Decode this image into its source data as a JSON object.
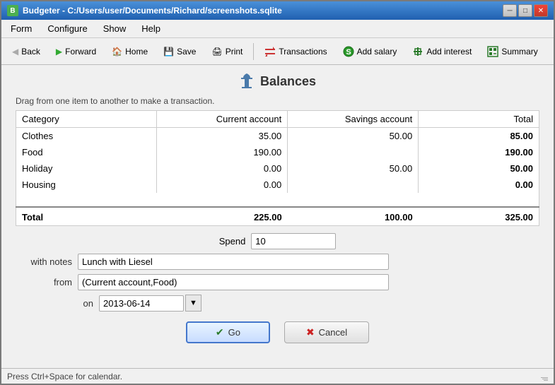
{
  "window": {
    "title": "Budgeter - C:/Users/user/Documents/Richard/screenshots.sqlite"
  },
  "menu": {
    "items": [
      {
        "id": "form",
        "label": "Form"
      },
      {
        "id": "configure",
        "label": "Configure"
      },
      {
        "id": "show",
        "label": "Show"
      },
      {
        "id": "help",
        "label": "Help"
      }
    ]
  },
  "toolbar": {
    "back_label": "Back",
    "forward_label": "Forward",
    "home_label": "Home",
    "save_label": "Save",
    "print_label": "Print",
    "transactions_label": "Transactions",
    "add_salary_label": "Add salary",
    "add_interest_label": "Add interest",
    "summary_label": "Summary"
  },
  "page": {
    "title": "Balances",
    "instruction": "Drag from one item to another to make a transaction."
  },
  "table": {
    "headers": [
      "Category",
      "Current account",
      "Savings account",
      "Total"
    ],
    "rows": [
      {
        "category": "Clothes",
        "current": "35.00",
        "savings": "50.00",
        "total": "85.00"
      },
      {
        "category": "Food",
        "current": "190.00",
        "savings": "",
        "total": "190.00"
      },
      {
        "category": "Holiday",
        "current": "0.00",
        "savings": "50.00",
        "total": "50.00"
      },
      {
        "category": "Housing",
        "current": "0.00",
        "savings": "",
        "total": "0.00"
      }
    ],
    "total_row": {
      "label": "Total",
      "current": "225.00",
      "savings": "100.00",
      "total": "325.00"
    }
  },
  "form": {
    "spend_label": "Spend",
    "spend_value": "10",
    "notes_label": "with notes",
    "notes_value": "Lunch with Liesel",
    "from_label": "from",
    "from_value": "(Current account,Food)",
    "on_label": "on",
    "date_value": "2013-06-14",
    "go_label": "Go",
    "cancel_label": "Cancel"
  },
  "status_bar": {
    "text": "Press Ctrl+Space for calendar."
  }
}
